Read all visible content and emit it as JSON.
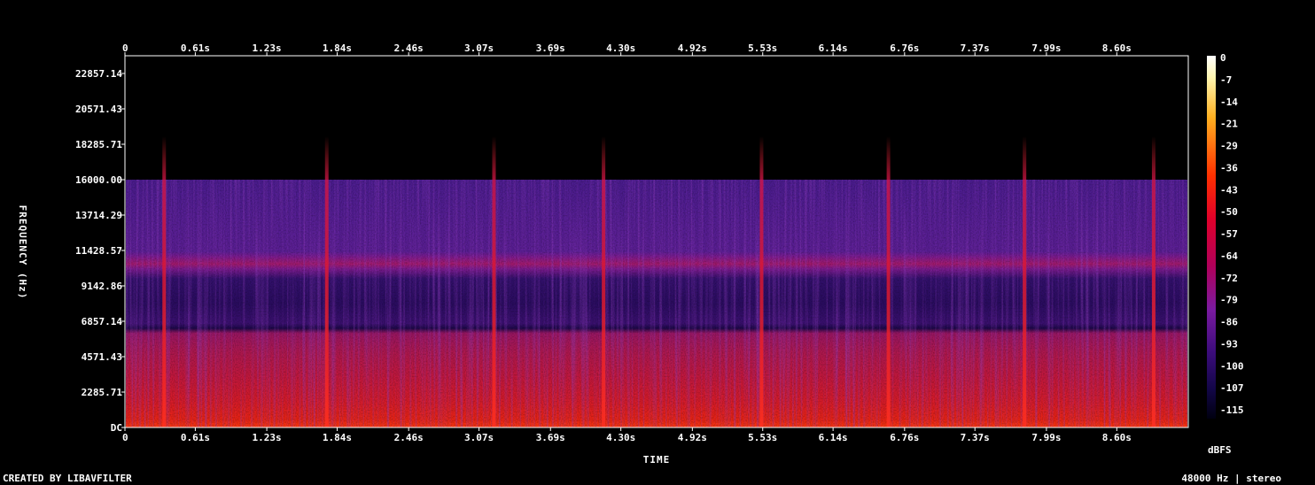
{
  "chart_data": {
    "type": "heatmap",
    "xlabel": "TIME",
    "ylabel": "FREQUENCY (Hz)",
    "x_ticks": [
      "0",
      "0.61s",
      "1.23s",
      "1.84s",
      "2.46s",
      "3.07s",
      "3.69s",
      "4.30s",
      "4.92s",
      "5.53s",
      "6.14s",
      "6.76s",
      "7.37s",
      "7.99s",
      "8.60s"
    ],
    "x_tick_values": [
      0,
      0.61,
      1.23,
      1.84,
      2.46,
      3.07,
      3.69,
      4.3,
      4.92,
      5.53,
      6.14,
      6.76,
      7.37,
      7.99,
      8.6
    ],
    "xlim": [
      0,
      9.22
    ],
    "y_ticks": [
      "DC",
      "2285.71",
      "4571.43",
      "6857.14",
      "9142.86",
      "11428.57",
      "13714.29",
      "16000.00",
      "18285.71",
      "20571.43",
      "22857.14"
    ],
    "y_tick_values": [
      0,
      2285.71,
      4571.43,
      6857.14,
      9142.86,
      11428.57,
      13714.29,
      16000.0,
      18285.71,
      20571.43,
      22857.14
    ],
    "ylim": [
      0,
      24000
    ],
    "colorbar": {
      "label": "dBFS",
      "ticks": [
        "0",
        "-7",
        "-14",
        "-21",
        "-29",
        "-36",
        "-43",
        "-50",
        "-57",
        "-64",
        "-72",
        "-79",
        "-86",
        "-93",
        "-100",
        "-107",
        "-115"
      ],
      "range": [
        -120,
        0
      ]
    },
    "cutoff_frequency": 16000,
    "transient_times": [
      0.34,
      1.75,
      3.2,
      4.15,
      5.52,
      6.62,
      7.8,
      8.92
    ]
  },
  "footer": {
    "left": "CREATED BY LIBAVFILTER",
    "right": "48000 Hz | stereo"
  },
  "colors": {
    "background": "#000000",
    "label": "#ffffff"
  }
}
